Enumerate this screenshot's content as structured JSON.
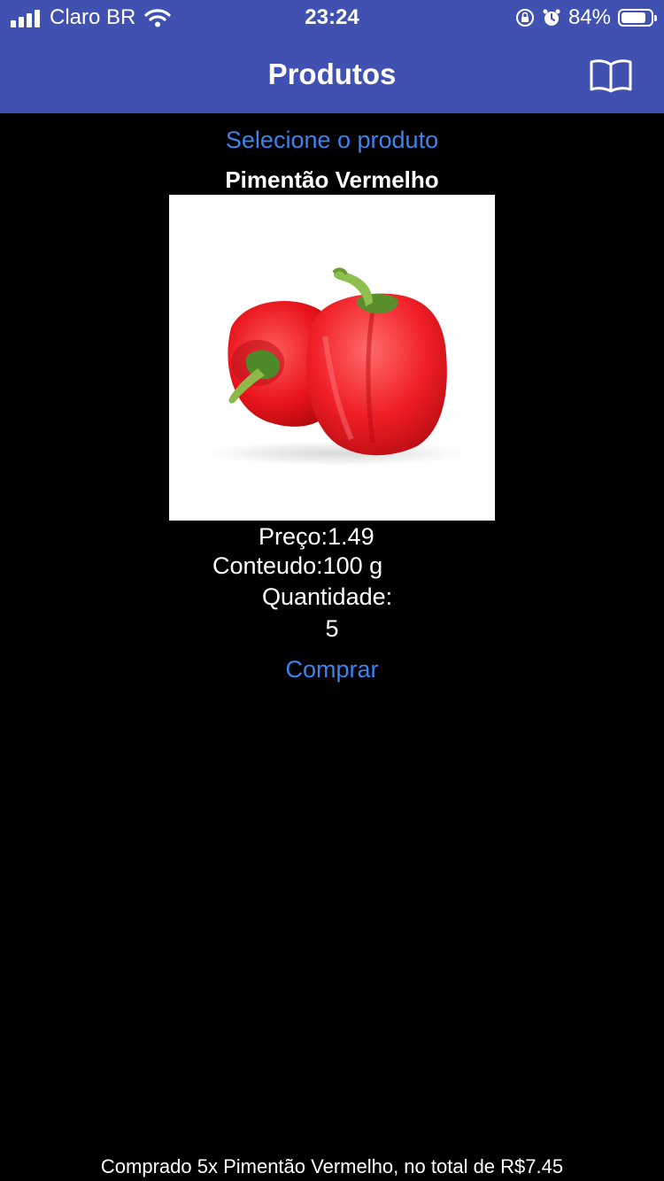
{
  "status_bar": {
    "carrier": "Claro BR",
    "time": "23:24",
    "battery_percent": "84%",
    "battery_level": 0.84,
    "icons": [
      "signal-bars-icon",
      "wifi-icon",
      "orientation-lock-icon",
      "alarm-icon",
      "battery-icon"
    ]
  },
  "nav": {
    "title": "Produtos",
    "right_icon": "book-icon",
    "background_color": "#4151b2"
  },
  "main": {
    "select_label": "Selecione o produto",
    "product_name": "Pimentão Vermelho",
    "product_image": "red-bell-pepper-image",
    "price_line": "Preço:1.49",
    "content_line": "Conteudo:100 g",
    "quantity_label": "Quantidade:",
    "quantity_value": "5",
    "buy_label": "Comprar",
    "accent_color": "#3b83ee"
  },
  "footer": {
    "message": "Comprado 5x Pimentão Vermelho, no total de R$7.45"
  }
}
